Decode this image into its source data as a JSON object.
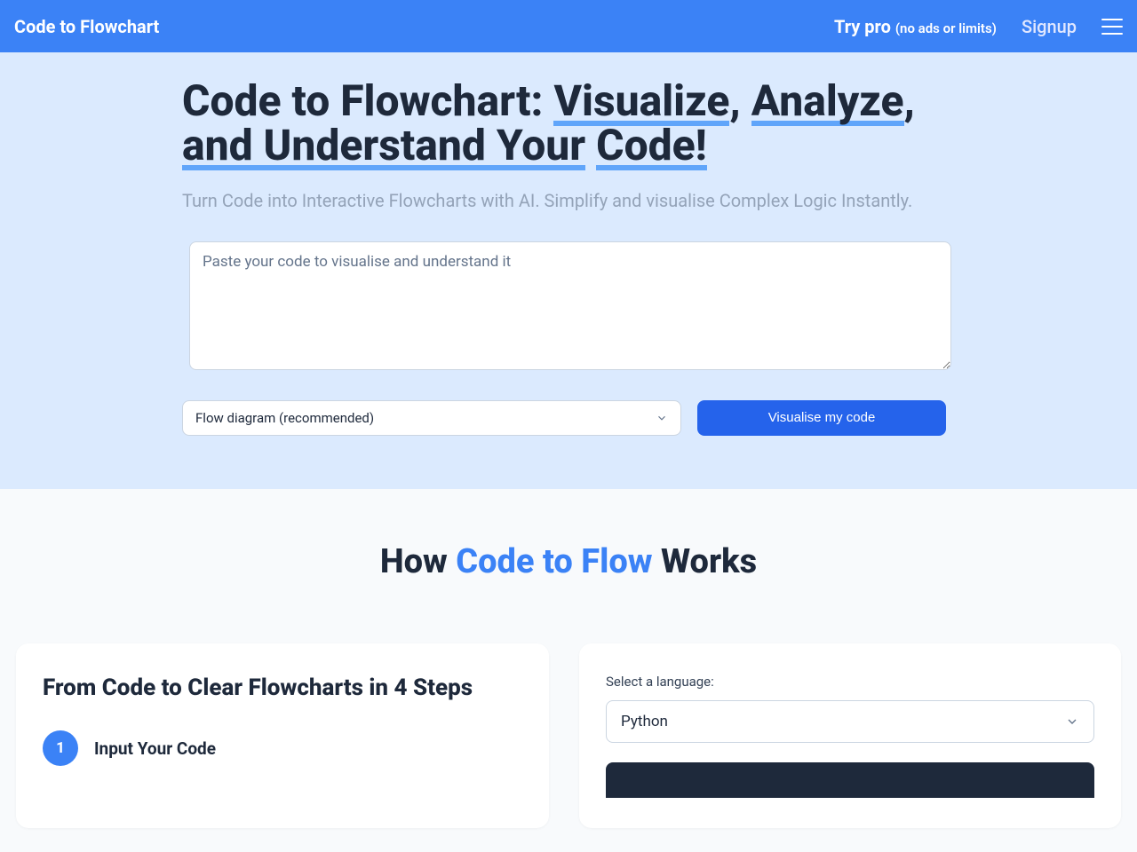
{
  "header": {
    "logo": "Code to Flowchart",
    "try_pro_main": "Try pro",
    "try_pro_sub": "(no ads or limits)",
    "signup": "Signup"
  },
  "hero": {
    "title_prefix": "Code to Flowchart: ",
    "title_seg1": "Visualize",
    "title_comma": ", ",
    "title_seg2": "Analyze",
    "title_comma2": ", ",
    "title_seg3": "and Understand Your",
    "title_space": " ",
    "title_seg4": "Code!",
    "subtitle": "Turn Code into Interactive Flowcharts with AI. Simplify and visualise Complex Logic Instantly.",
    "textarea_placeholder": "Paste your code to visualise and understand it",
    "select_value": "Flow diagram (recommended)",
    "button": "Visualise my code"
  },
  "how": {
    "title_pre": "How ",
    "title_accent": "Code to Flow",
    "title_post": " Works",
    "left_card_title": "From Code to Clear Flowcharts in 4 Steps",
    "step1_num": "1",
    "step1_label": "Input Your Code",
    "lang_label": "Select a language:",
    "lang_value": "Python"
  },
  "colors": {
    "primary": "#3b82f6",
    "primary_dark": "#2563eb",
    "hero_bg": "#dbeafe",
    "text": "#1e293b",
    "muted": "#94a3b8"
  }
}
